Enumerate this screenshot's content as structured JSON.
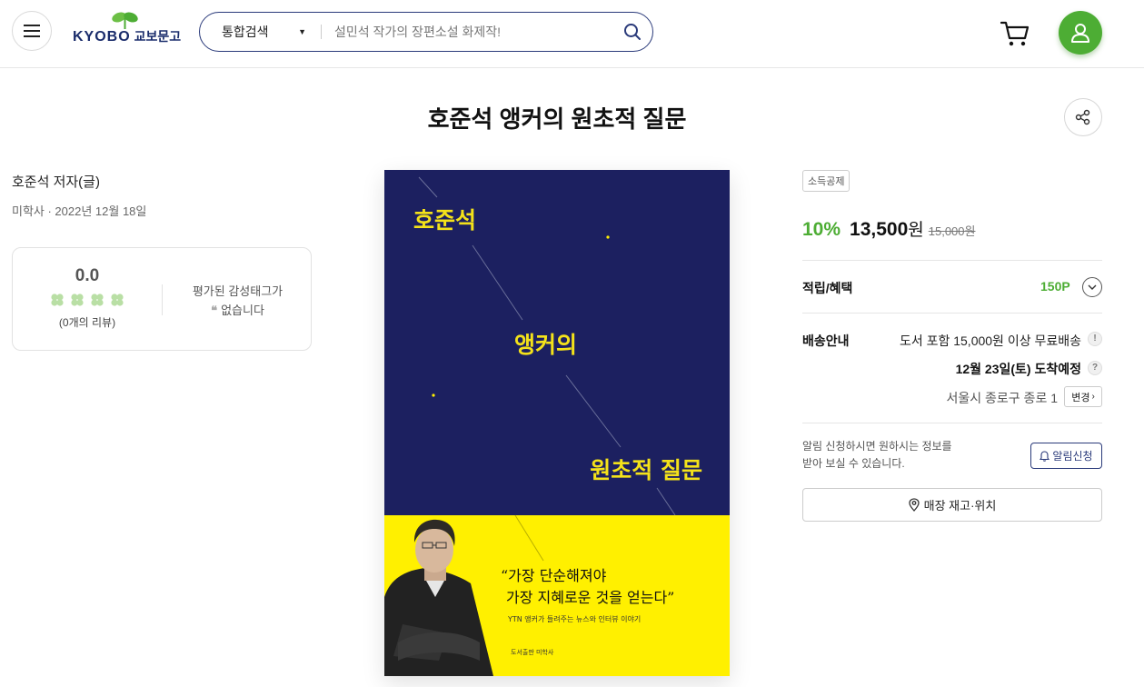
{
  "header": {
    "logo_text": "KYOBO",
    "logo_text_kr": "교보문고",
    "search": {
      "category": "통합검색",
      "placeholder": "설민석 작가의 장편소설 화제작!"
    }
  },
  "book": {
    "title": "호준석 앵커의 원초적 질문",
    "author": "호준석 저자(글)",
    "publisher_date": "미학사 · 2022년 12월 18일",
    "review": {
      "score": "0.0",
      "count_text": "(0개의 리뷰)",
      "emotion_line1": "평가된 감성태그가",
      "emotion_line2": "없습니다"
    },
    "cover": {
      "title_line1": "호준석",
      "title_line2": "앵커의",
      "title_line3": "원초적 질문",
      "quote_line1": "“가장 단순해져야",
      "quote_line2": "가장 지혜로운 것을 얻는다”",
      "subtitle": "YTN 앵커가 들려주는 뉴스와 인터뷰 이야기",
      "publisher": "도서출판 미학사",
      "colors": {
        "navy": "#1c2060",
        "yellow": "#fff000",
        "title_yellow": "#f4e21a"
      }
    }
  },
  "purchase": {
    "tag": "소득공제",
    "discount": "10%",
    "price": "13,500",
    "won": "원",
    "original_price": "15,000원",
    "points_label": "적립/혜택",
    "points": "150P",
    "shipping_label": "배송안내",
    "shipping_free": "도서 포함 15,000원 이상 무료배송",
    "arrival": "12월 23일(토) 도착예정",
    "address": "서울시 종로구 종로 1",
    "change_label": "변경",
    "alert_line1": "알림 신청하시면 원하시는 정보를",
    "alert_line2": "받아 보실 수 있습니다.",
    "alert_button": "알림신청",
    "store_button": "매장 재고·위치"
  },
  "colors": {
    "brand_green": "#4dad34",
    "brand_navy": "#2a3a7a"
  }
}
